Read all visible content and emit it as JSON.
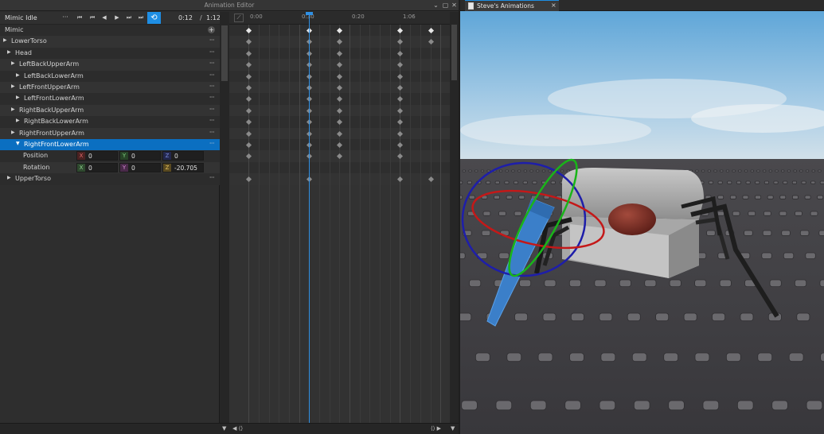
{
  "editor": {
    "title": "Animation Editor",
    "toolbar": {
      "animation_name": "Mimic Idle",
      "more": "···",
      "current_time": "0:12",
      "separator": "/",
      "length": "1:12"
    },
    "tracks_header": {
      "label": "Mimic",
      "add": "+"
    },
    "tracks": [
      {
        "label": "LowerTorso",
        "indent": 0,
        "expanded": false
      },
      {
        "label": "Head",
        "indent": 1,
        "expanded": false
      },
      {
        "label": "LeftBackUpperArm",
        "indent": 1,
        "expanded": false
      },
      {
        "label": "LeftBackLowerArm",
        "indent": 2,
        "expanded": false
      },
      {
        "label": "LeftFrontUpperArm",
        "indent": 1,
        "expanded": false
      },
      {
        "label": "LeftFrontLowerArm",
        "indent": 2,
        "expanded": false
      },
      {
        "label": "RightBackUpperArm",
        "indent": 1,
        "expanded": false
      },
      {
        "label": "RightBackLowerArm",
        "indent": 2,
        "expanded": false
      },
      {
        "label": "RightFrontUpperArm",
        "indent": 1,
        "expanded": false
      },
      {
        "label": "RightFrontLowerArm",
        "indent": 2,
        "expanded": true,
        "selected": true
      }
    ],
    "properties": [
      {
        "label": "Position",
        "x": "0",
        "y": "0",
        "z": "0"
      },
      {
        "label": "Rotation",
        "x": "0",
        "y": "0",
        "z": "-20.705"
      }
    ],
    "last_track": {
      "label": "UpperTorso"
    },
    "timeline": {
      "ticks": [
        "0:00",
        "0:30",
        "0:20",
        "1:06"
      ]
    },
    "colors": {
      "accent": "#1e8ee4",
      "selected_row": "#0b6fc1"
    }
  },
  "viewport": {
    "tab_label": "Steve's Animations",
    "tab_close": "×"
  }
}
